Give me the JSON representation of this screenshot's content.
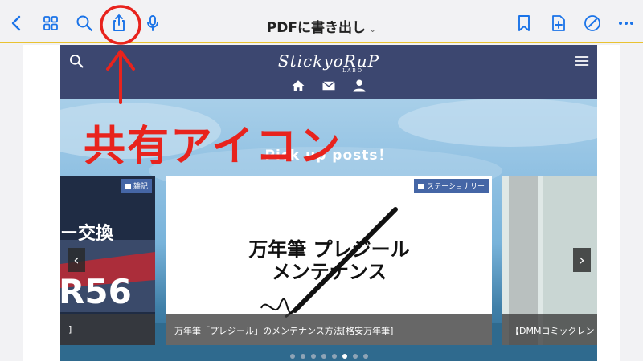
{
  "toolbar": {
    "title": "PDFに書き出し",
    "title_chevron": "⌄",
    "back_icon": "chevron-left-icon",
    "grid_icon": "grid-icon",
    "search_icon": "search-icon",
    "share_icon": "share-icon",
    "mic_icon": "microphone-icon",
    "bookmark_icon": "bookmark-icon",
    "add_page_icon": "add-page-icon",
    "markup_icon": "markup-pen-icon",
    "more_icon": "more-icon",
    "accent_color": "#1a73e8"
  },
  "annotation": {
    "label": "共有アイコン",
    "color": "#e8231d"
  },
  "site": {
    "logo": "StickyoRuP",
    "logo_sub": "LABO",
    "pickup_title": "Pick up posts！",
    "cards": [
      {
        "badge": "雑記",
        "headline_top": "ー交換",
        "headline_big": "R56",
        "caption": "]"
      },
      {
        "badge": "ステーショナリー",
        "headline_line1": "万年筆 プレジール",
        "headline_line2": "メンテナンス",
        "caption": "万年筆「プレジール」のメンテナンス方法[格安万年筆]"
      },
      {
        "badge": "",
        "caption": "【DMMコミックレン"
      }
    ],
    "prev_arrow": "‹",
    "next_arrow": "›",
    "dots_count": 8,
    "active_dot": 5
  }
}
